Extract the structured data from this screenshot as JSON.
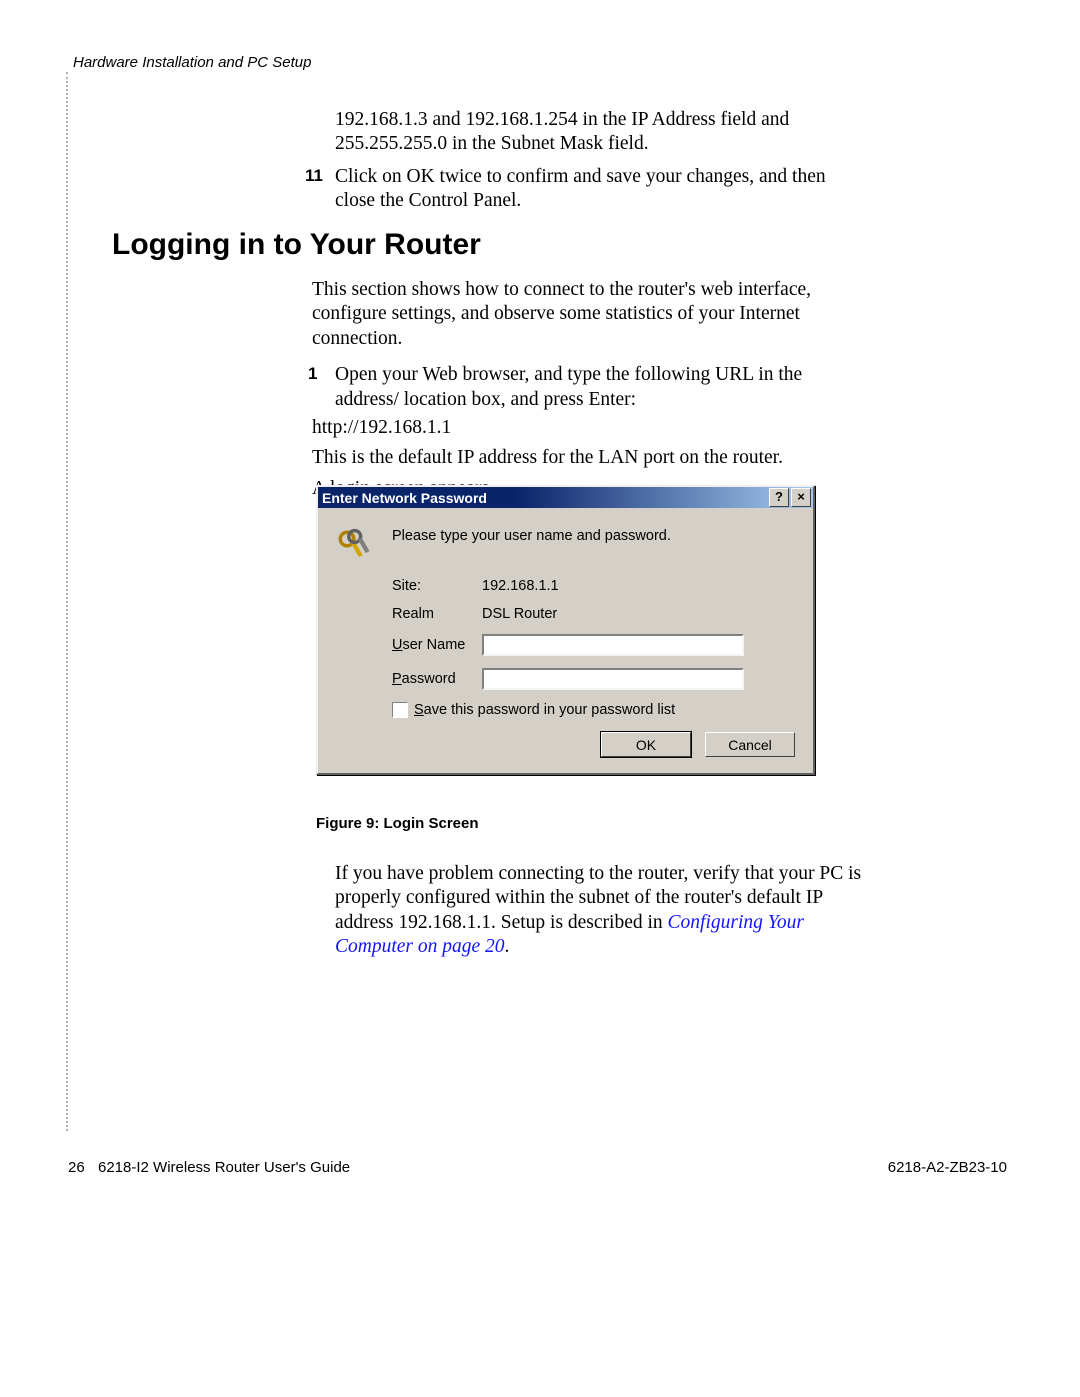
{
  "running_head": "Hardware Installation and PC Setup",
  "continuation": {
    "para": "192.168.1.3 and 192.168.1.254 in the IP Address field and 255.255.255.0 in the Subnet Mask field.",
    "step11_num": "11",
    "step11_text": "Click on OK twice to confirm and save your changes, and then close the Control Panel."
  },
  "heading": "Logging in to Your Router",
  "intro": "This section shows how to connect to the router's web interface, configure settings, and observe some statistics of your Internet connection.",
  "step1": {
    "num": "1",
    "text": "Open your Web browser, and type the following URL in the address/ location box, and press Enter:",
    "url": "http://192.168.1.1",
    "after1": "This is the default IP address for the LAN port on the router.",
    "after2": "A login screen appears."
  },
  "dialog": {
    "title": "Enter Network Password",
    "help_glyph": "?",
    "close_glyph": "×",
    "instruction": "Please type your user name and password.",
    "site_label": "Site:",
    "site_value": "192.168.1.1",
    "realm_label": "Realm",
    "realm_value": "DSL Router",
    "user_label_u": "U",
    "user_label_rest": "ser Name",
    "pass_label_u": "P",
    "pass_label_rest": "assword",
    "save_u": "S",
    "save_rest": "ave this password in your password list",
    "ok": "OK",
    "cancel": "Cancel",
    "username_value": "",
    "password_value": ""
  },
  "figure_caption": "Figure 9: Login Screen",
  "after_para_plain": "If you have problem connecting to the router, verify that your PC is properly configured within the subnet of the router's default IP address 192.168.1.1. Setup is described in ",
  "after_para_xref": "Configuring Your Computer on page 20",
  "after_para_tail": ".",
  "footer": {
    "page_num": "26",
    "title": "6218-I2 Wireless Router User's Guide",
    "code": "6218-A2-ZB23-10"
  }
}
